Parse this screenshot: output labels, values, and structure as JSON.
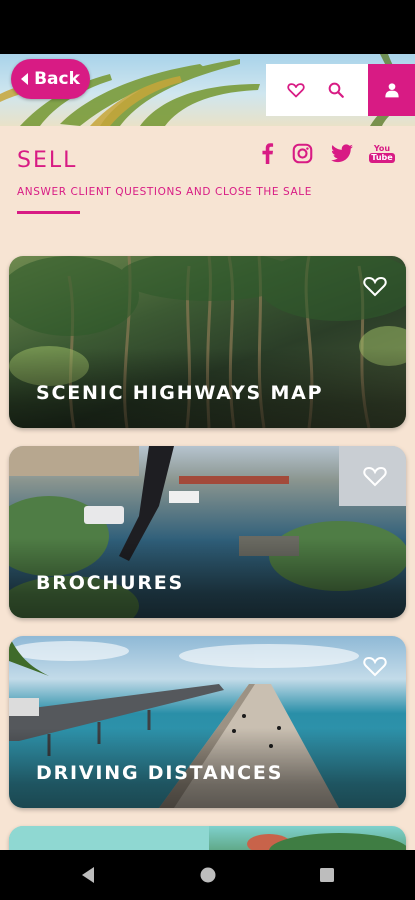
{
  "header": {
    "back_label": "Back",
    "icons": [
      "heart-icon",
      "search-icon",
      "user-icon"
    ]
  },
  "section": {
    "title": "SELL",
    "subtitle": "ANSWER CLIENT QUESTIONS AND CLOSE THE SALE",
    "social_icons": [
      "facebook-icon",
      "instagram-icon",
      "twitter-icon",
      "youtube-icon"
    ],
    "youtube_text_top": "You",
    "youtube_text_bottom": "Tube"
  },
  "cards": [
    {
      "label": "SCENIC HIGHWAYS MAP"
    },
    {
      "label": "BROCHURES"
    },
    {
      "label": "DRIVING DISTANCES"
    }
  ],
  "colors": {
    "brand_pink": "#d81b84",
    "background": "#f7e4d3"
  },
  "navigation": [
    "back-triangle-icon",
    "home-circle-icon",
    "recents-square-icon"
  ]
}
